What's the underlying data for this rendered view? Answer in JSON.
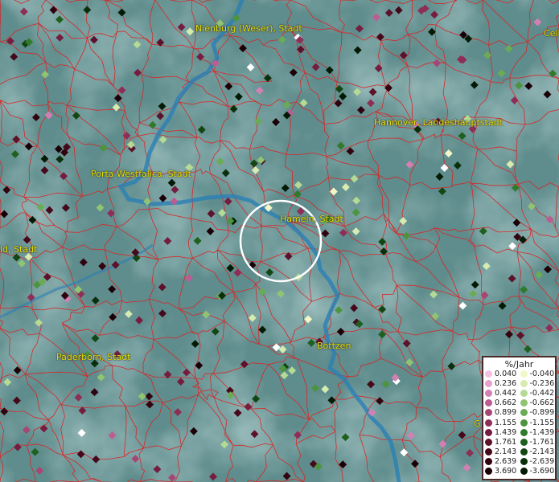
{
  "map": {
    "place_labels": [
      {
        "id": "nienburg",
        "text": "Nienburg (Weser), Stadt"
      },
      {
        "id": "celle",
        "text": "Celle"
      },
      {
        "id": "hannover",
        "text": "Hannover, Landeshauptstadt"
      },
      {
        "id": "porta",
        "text": "Porta Westfalica, Stadt"
      },
      {
        "id": "hameln",
        "text": "Hameln, Stadt"
      },
      {
        "id": "bielefeld",
        "text": "ld, Stadt"
      },
      {
        "id": "paderborn",
        "text": "Paderborn, Stadt"
      },
      {
        "id": "bottrop",
        "text": "Bottzen"
      },
      {
        "id": "gottingen",
        "text": "G"
      }
    ],
    "colors": {
      "background": "#5f8c8c",
      "boundary": "#d62828",
      "river": "#2a7fb5",
      "label": "#e8e000",
      "highlight_circle": "#ffffff"
    }
  },
  "legend": {
    "title": "%/Jahr",
    "positive": [
      {
        "label": "0.040",
        "color": "#f7bfe6"
      },
      {
        "label": "0.236",
        "color": "#e79fcf"
      },
      {
        "label": "0.442",
        "color": "#d47fb3"
      },
      {
        "label": "0.662",
        "color": "#bd5c92"
      },
      {
        "label": "0.899",
        "color": "#a64674"
      },
      {
        "label": "1.155",
        "color": "#8e2e57"
      },
      {
        "label": "1.439",
        "color": "#761d3f"
      },
      {
        "label": "1.761",
        "color": "#5d112b"
      },
      {
        "label": "2.143",
        "color": "#46081b"
      },
      {
        "label": "2.639",
        "color": "#30030f"
      },
      {
        "label": "3.690",
        "color": "#1a0006"
      }
    ],
    "negative": [
      {
        "label": "-0.040",
        "color": "#f2f7c8"
      },
      {
        "label": "-0.236",
        "color": "#d6ebb0"
      },
      {
        "label": "-0.442",
        "color": "#b5da93"
      },
      {
        "label": "-0.662",
        "color": "#90c473"
      },
      {
        "label": "-0.899",
        "color": "#6aac55"
      },
      {
        "label": "-1.155",
        "color": "#4c943f"
      },
      {
        "label": "-1.439",
        "color": "#317a2c"
      },
      {
        "label": "-1.761",
        "color": "#1e601e"
      },
      {
        "label": "-2.143",
        "color": "#124713"
      },
      {
        "label": "-2.639",
        "color": "#0a300b"
      },
      {
        "label": "-3.690",
        "color": "#031a04"
      }
    ]
  }
}
